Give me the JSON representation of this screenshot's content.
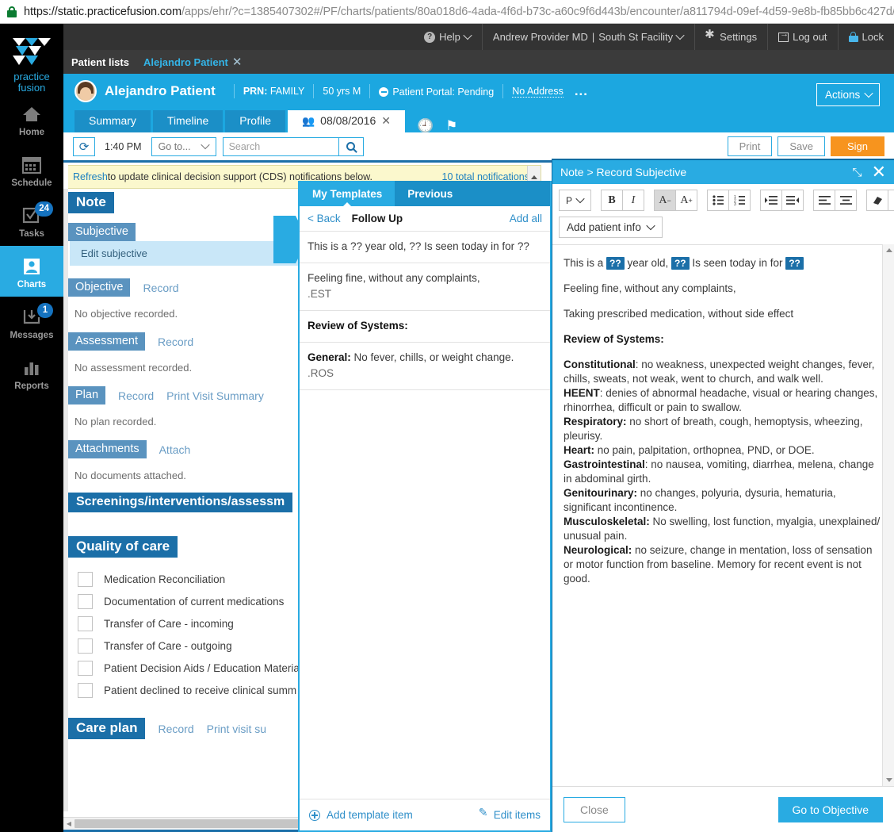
{
  "browser": {
    "url_prefix": "https://static.practicefusion.com",
    "url_rest": "/apps/ehr/?c=1385407302#/PF/charts/patients/80a018d6-4ada-4f6d-b73c-a60c9f6d443b/encounter/a811794d-09ef-4d59-9e8b-fb85bb6c427d/n",
    "lock_icon": "lock-icon"
  },
  "topnav": {
    "help": "Help",
    "provider": "Andrew Provider MD",
    "facility": "South St Facility",
    "settings": "Settings",
    "logout": "Log out",
    "lock": "Lock"
  },
  "sidebar": {
    "brand_line1": "practice",
    "brand_line2": "fusion",
    "items": [
      {
        "label": "Home",
        "icon": "home-icon",
        "badge": ""
      },
      {
        "label": "Schedule",
        "icon": "calendar-icon",
        "badge": ""
      },
      {
        "label": "Tasks",
        "icon": "checklist-icon",
        "badge": "24"
      },
      {
        "label": "Charts",
        "icon": "person-card-icon",
        "badge": ""
      },
      {
        "label": "Messages",
        "icon": "inbox-download-icon",
        "badge": "1"
      },
      {
        "label": "Reports",
        "icon": "bar-chart-icon",
        "badge": ""
      }
    ]
  },
  "tabbar": {
    "patient_lists": "Patient lists",
    "open_patient": "Alejandro Patient",
    "close": "✕"
  },
  "patient": {
    "name": "Alejandro Patient",
    "prn_label": "PRN:",
    "prn_value": "FAMILY",
    "age_sex": "50 yrs M",
    "portal": "Patient Portal: Pending",
    "address": "No Address",
    "more": "...",
    "actions_button": "Actions",
    "subtabs": [
      {
        "label": "Summary",
        "selected": false
      },
      {
        "label": "Timeline",
        "selected": false
      },
      {
        "label": "Profile",
        "selected": false
      },
      {
        "label": "08/08/2016",
        "selected": true
      }
    ]
  },
  "actionbar": {
    "refresh_icon": "refresh-icon",
    "time": "1:40 PM",
    "goto": "Go to...",
    "search_placeholder": "Search",
    "search_value": "",
    "print": "Print",
    "save": "Save",
    "sign": "Sign"
  },
  "cds": {
    "link": "Refresh",
    "text": " to update clinical decision support (CDS) notifications below.",
    "count": "10 total notifications"
  },
  "note": {
    "title": "Note",
    "subjective_label": "Subjective",
    "edit_subjective": "Edit subjective",
    "objective_label": "Objective",
    "objective_record": "Record",
    "objective_empty": "No objective recorded.",
    "assessment_label": "Assessment",
    "assessment_record": "Record",
    "assessment_empty": "No assessment recorded.",
    "plan_label": "Plan",
    "plan_record": "Record",
    "plan_print": "Print Visit Summary",
    "plan_empty": "No plan recorded.",
    "attachments_label": "Attachments",
    "attach_link": "Attach",
    "attachments_empty": "No documents attached.",
    "screenings_label": "Screenings/interventions/assessm",
    "quality_label": "Quality of care",
    "quality_items": [
      "Medication Reconciliation",
      "Documentation of current medications",
      "Transfer of Care - incoming",
      "Transfer of Care - outgoing",
      "Patient Decision Aids / Education Materia",
      "Patient declined to receive clinical summ"
    ],
    "careplan_label": "Care plan",
    "careplan_record": "Record",
    "careplan_print": "Print visit su"
  },
  "templates": {
    "tabs": [
      {
        "label": "My Templates",
        "selected": true
      },
      {
        "label": "Previous",
        "selected": false
      }
    ],
    "back": "< Back",
    "name": "Follow Up",
    "add_all": "Add all",
    "items": [
      {
        "line1": "This is a ?? year old, ?? Is seen today in for ??",
        "line2": "",
        "code": ""
      },
      {
        "line1": "Feeling fine, without any complaints,",
        "line2": "",
        "code": ".EST"
      },
      {
        "line1": "Review of Systems:",
        "bold1": true,
        "line2": "",
        "code": ""
      },
      {
        "line1": "General:",
        "bold1": true,
        "line1b": " No fever, chills, or weight change.",
        "code": ".ROS"
      }
    ],
    "add_item": "Add template item",
    "edit_items": "Edit items"
  },
  "editor": {
    "title": "Note > Record Subjective",
    "resize_icon": "resize-icon",
    "close_icon": "close-icon",
    "toolbar": {
      "paragraph": "P",
      "bold": "B",
      "italic": "I",
      "font_smaller": "A⁻",
      "font_larger": "A⁺",
      "bullet_list": "bullet-list-icon",
      "numbered_list": "numbered-list-icon",
      "indent": "indent-icon",
      "outdent": "outdent-icon",
      "align_left": "align-left-icon",
      "align_center": "align-center-icon",
      "clear_format": "eraser-icon",
      "undo": "undo-icon",
      "add_patient_info": "Add patient info"
    },
    "content": {
      "line1_a": "This is a ",
      "line1_tok1": "??",
      "line1_b": " year old, ",
      "line1_tok2": "??",
      "line1_c": " Is seen today in for ",
      "line1_tok3": "??",
      "line2": "Feeling fine, without any complaints,",
      "line3": "Taking prescribed medication, without side effect",
      "ros_heading": "Review of Systems:",
      "ros": [
        {
          "label": "Constitutional",
          "sep": ":",
          "text": " no weakness, unexpected weight changes, fever, chills, sweats, not weak, went to church, and walk well."
        },
        {
          "label": "HEENT",
          "sep": ":",
          "text": " denies of abnormal headache, visual or hearing changes, rhinorrhea, difficult or pain to swallow."
        },
        {
          "label": "Respiratory:",
          "sep": "",
          "text": " no short of breath, cough, hemoptysis, wheezing, pleurisy."
        },
        {
          "label": "Heart:",
          "sep": "",
          "text": " no pain, palpitation, orthopnea, PND, or DOE."
        },
        {
          "label": "Gastrointestinal",
          "sep": ":",
          "text": " no nausea, vomiting, diarrhea, melena, change in abdominal girth."
        },
        {
          "label": "Genitourinary:",
          "sep": "",
          "text": " no changes, polyuria, dysuria, hematuria, significant incontinence."
        },
        {
          "label": "Musculoskeletal:",
          "sep": "",
          "text": " No swelling, lost function, myalgia, unexplained/ unusual pain."
        },
        {
          "label": "Neurological:",
          "sep": "",
          "text": " no seizure, change in mentation, loss of sensation or motor function from baseline. Memory for recent event is not good."
        }
      ]
    },
    "close_button": "Close",
    "primary_button": "Go to Objective"
  },
  "colors": {
    "brand_blue": "#29abe2",
    "dark_blue": "#1b6fa8",
    "orange": "#f7941e",
    "yellow": "#fbf8cd"
  }
}
